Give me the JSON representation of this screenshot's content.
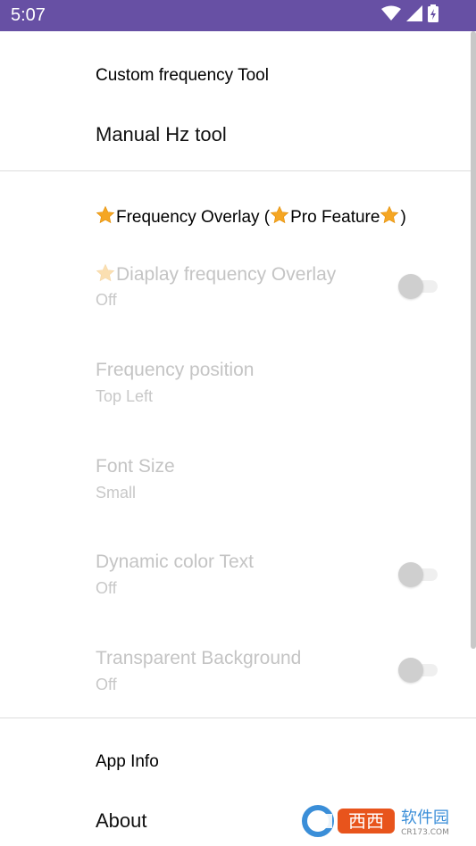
{
  "status_bar": {
    "time": "5:07",
    "icons": [
      "wifi-icon",
      "signal-icon",
      "battery-charging-icon"
    ]
  },
  "sections": {
    "custom_tool_header": "Custom frequency Tool",
    "manual_hz": "Manual Hz tool",
    "overlay_header_parts": {
      "part1": "Frequency Overlay (",
      "part2": "Pro Feature",
      "part3": ")"
    },
    "app_info_header": "App Info",
    "about": "About"
  },
  "preferences": {
    "display_overlay": {
      "title": "Diaplay frequency Overlay",
      "summary": "Off",
      "checked": false
    },
    "frequency_position": {
      "title": "Frequency position",
      "summary": "Top Left"
    },
    "font_size": {
      "title": "Font Size",
      "summary": "Small"
    },
    "dynamic_color": {
      "title": "Dynamic color Text",
      "summary": "Off",
      "checked": false
    },
    "transparent_bg": {
      "title": "Transparent Background",
      "summary": "Off",
      "checked": false
    }
  },
  "colors": {
    "status_bar": "#6750a4",
    "disabled_text": "#c4c4c4",
    "star": "#f5a623"
  },
  "watermark": {
    "brand": "西西软件园",
    "domain": "CR173.COM"
  }
}
